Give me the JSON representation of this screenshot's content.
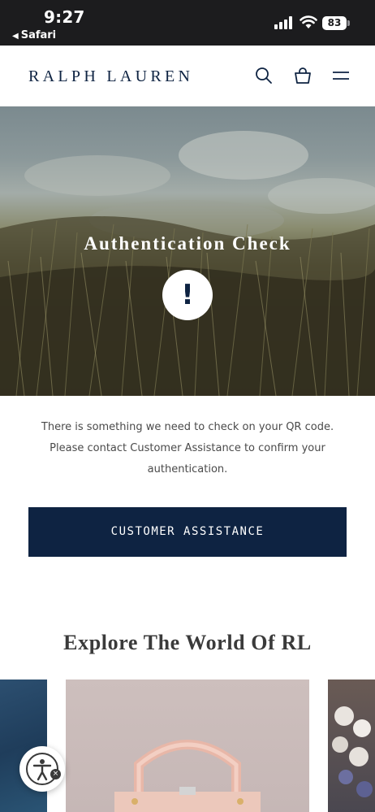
{
  "status_bar": {
    "time": "9:27",
    "back_app": "Safari",
    "battery_percent": "83"
  },
  "header": {
    "logo": "RALPH LAUREN",
    "icons": [
      "search-icon",
      "shopping-bag-icon",
      "hamburger-menu-icon"
    ]
  },
  "hero": {
    "title": "Authentication Check",
    "alert_glyph": "!"
  },
  "message": {
    "line1": "There is something we need to check on your QR code.",
    "line2": "Please contact Customer Assistance to confirm your",
    "line3": "authentication."
  },
  "cta": {
    "label": "CUSTOMER ASSISTANCE"
  },
  "explore": {
    "title": "Explore The World Of RL"
  },
  "accessibility": {
    "icon": "accessibility-icon",
    "close_glyph": "×"
  },
  "colors": {
    "brand_navy": "#0e2342",
    "status_bar": "#1c1c1e",
    "body_text": "#4a4a4a"
  }
}
